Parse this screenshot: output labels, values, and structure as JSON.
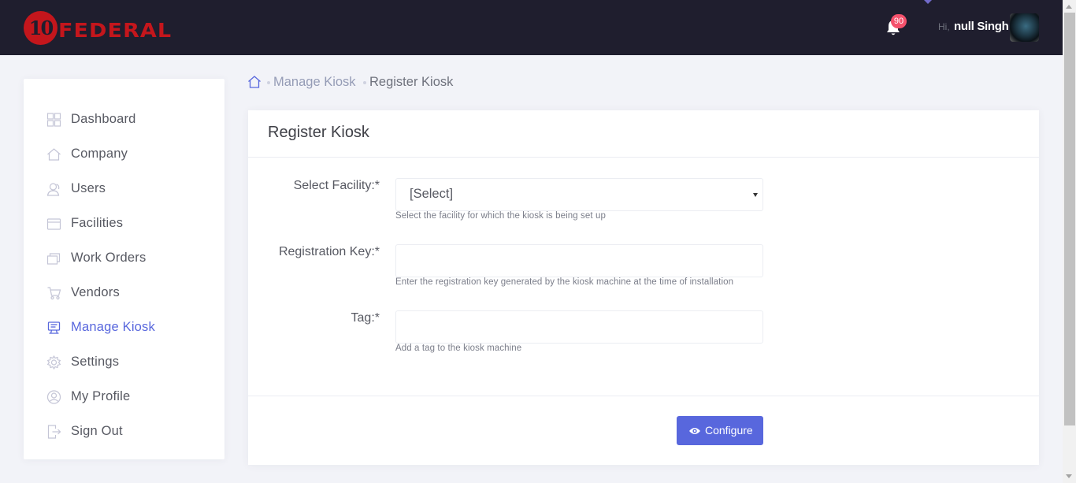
{
  "header": {
    "logo_number": "10",
    "logo_text": "FEDERAL",
    "notifications_count": "90",
    "greeting": "Hi,",
    "username": "null Singh"
  },
  "sidebar": {
    "items": [
      {
        "label": "Dashboard",
        "icon": "dashboard-icon"
      },
      {
        "label": "Company",
        "icon": "home-icon"
      },
      {
        "label": "Users",
        "icon": "users-icon"
      },
      {
        "label": "Facilities",
        "icon": "facilities-icon"
      },
      {
        "label": "Work Orders",
        "icon": "work-orders-icon"
      },
      {
        "label": "Vendors",
        "icon": "cart-icon"
      },
      {
        "label": "Manage Kiosk",
        "icon": "kiosk-icon",
        "active": true
      },
      {
        "label": "Settings",
        "icon": "gear-icon"
      },
      {
        "label": "My Profile",
        "icon": "profile-icon"
      },
      {
        "label": "Sign Out",
        "icon": "sign-out-icon"
      }
    ]
  },
  "breadcrumb": {
    "parent": "Manage Kiosk",
    "current": "Register Kiosk"
  },
  "form": {
    "title": "Register Kiosk",
    "facility": {
      "label": "Select Facility:*",
      "value": "[Select]",
      "help": "Select the facility for which the kiosk is being set up"
    },
    "registration_key": {
      "label": "Registration Key:*",
      "value": "",
      "help": "Enter the registration key generated by the kiosk machine at the time of installation"
    },
    "tag": {
      "label": "Tag:*",
      "value": "",
      "help": "Add a tag to the kiosk machine"
    },
    "submit_label": "Configure"
  },
  "colors": {
    "header_bg": "#1f1e2e",
    "accent": "#5867dd",
    "brand_red": "#c4161c",
    "badge": "#f4516c"
  }
}
